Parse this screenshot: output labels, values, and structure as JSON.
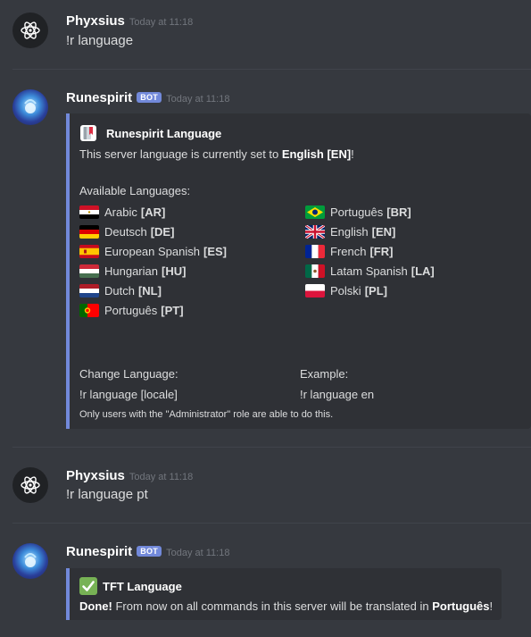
{
  "messages": [
    {
      "author": "Phyxsius",
      "timestamp": "Today at 11:18",
      "text": "!r language"
    },
    {
      "author": "Runespirit",
      "badge": "BOT",
      "timestamp": "Today at 11:18"
    },
    {
      "author": "Phyxsius",
      "timestamp": "Today at 11:18",
      "text": "!r language pt"
    },
    {
      "author": "Runespirit",
      "badge": "BOT",
      "timestamp": "Today at 11:18"
    }
  ],
  "embed1": {
    "title": "Runespirit Language",
    "desc_prefix": "This server language is currently set to ",
    "desc_value": "English [EN]",
    "desc_suffix": "!",
    "available_label": "Available Languages:",
    "languages_left": [
      {
        "name": "Arabic",
        "code": "[AR]",
        "flag": "eg"
      },
      {
        "name": "Deutsch",
        "code": "[DE]",
        "flag": "de"
      },
      {
        "name": "European Spanish",
        "code": "[ES]",
        "flag": "es"
      },
      {
        "name": "Hungarian",
        "code": "[HU]",
        "flag": "hu"
      },
      {
        "name": "Dutch",
        "code": "[NL]",
        "flag": "nl"
      },
      {
        "name": "Português",
        "code": "[PT]",
        "flag": "pt"
      }
    ],
    "languages_right": [
      {
        "name": "Português",
        "code": "[BR]",
        "flag": "br"
      },
      {
        "name": "English",
        "code": "[EN]",
        "flag": "gb"
      },
      {
        "name": "French",
        "code": "[FR]",
        "flag": "fr"
      },
      {
        "name": "Latam Spanish",
        "code": "[LA]",
        "flag": "mx"
      },
      {
        "name": "Polski",
        "code": "[PL]",
        "flag": "pl"
      }
    ],
    "change_label": "Change Language:",
    "change_value": "!r language [locale]",
    "example_label": "Example:",
    "example_value": "!r language en",
    "footer": "Only users with the \"Administrator\" role are able to do this."
  },
  "embed2": {
    "title": "TFT Language",
    "done_label": "Done!",
    "text": " From now on all commands in this server will be translated in ",
    "language": "Português",
    "suffix": "!"
  },
  "colors": {
    "accent": "#7289da",
    "background": "#36393f",
    "embed_bg": "#2f3136"
  }
}
